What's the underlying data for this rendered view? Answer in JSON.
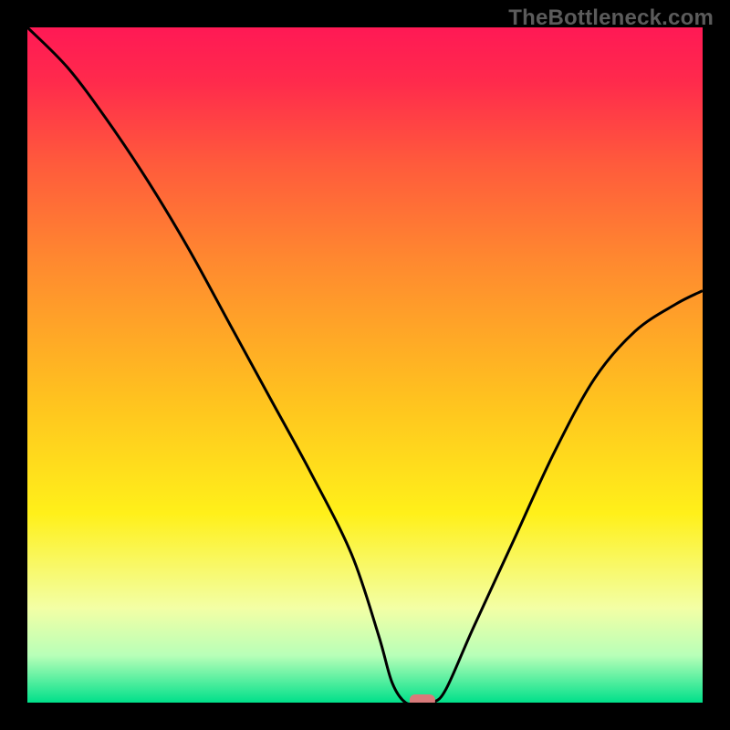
{
  "watermark": "TheBottleneck.com",
  "chart_data": {
    "type": "line",
    "title": "",
    "xlabel": "",
    "ylabel": "",
    "xlim": [
      0,
      100
    ],
    "ylim": [
      0,
      100
    ],
    "x": [
      0,
      6,
      12,
      18,
      24,
      30,
      36,
      42,
      48,
      52,
      54,
      56,
      58,
      60,
      62,
      66,
      72,
      78,
      84,
      90,
      96,
      100
    ],
    "values": [
      100,
      94,
      86,
      77,
      67,
      56,
      45,
      34,
      22,
      10,
      3,
      0,
      0,
      0,
      2,
      11,
      24,
      37,
      48,
      55,
      59,
      61
    ],
    "marker": {
      "x": 58.5,
      "y": 0
    },
    "gradient_stops": [
      {
        "offset": 0,
        "color": "#ff1955"
      },
      {
        "offset": 0.08,
        "color": "#ff2a4c"
      },
      {
        "offset": 0.2,
        "color": "#ff5a3c"
      },
      {
        "offset": 0.35,
        "color": "#ff8a2f"
      },
      {
        "offset": 0.55,
        "color": "#ffc21f"
      },
      {
        "offset": 0.72,
        "color": "#fff01a"
      },
      {
        "offset": 0.86,
        "color": "#f3ffa5"
      },
      {
        "offset": 0.93,
        "color": "#b8ffb8"
      },
      {
        "offset": 1.0,
        "color": "#00e08a"
      }
    ],
    "curve_color": "#000000",
    "marker_color": "#d97a7a"
  }
}
